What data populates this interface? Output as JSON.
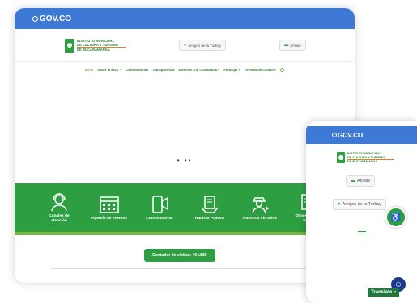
{
  "desktop": {
    "gov_logo": "GOV.CO",
    "brand": {
      "line1": "INSTITUTO MUNICIPAL",
      "line2": "DE CULTURA Y TURISMO",
      "line3": "DE BUCARAMANGA"
    },
    "header_buttons": {
      "amigos": "Amigos de la Turbay",
      "afiliate": "Afíliate"
    },
    "nav": [
      "Inicio",
      "Sobre el IMCT ˅",
      "Convocatorias",
      "Transparencia",
      "Atención a la Ciudadanía ˅",
      "Participa ˅",
      "Eventos de Ciudad ˅"
    ],
    "dots": "• ••",
    "services": [
      {
        "label": "Canales de atención",
        "icon": "headset-icon"
      },
      {
        "label": "Agenda de eventos",
        "icon": "calendar-icon"
      },
      {
        "label": "Convocatorias",
        "icon": "megaphone-phone-icon"
      },
      {
        "label": "Radicar PQRSD",
        "icon": "hand-document-icon"
      },
      {
        "label": "Nuestros circuitos",
        "icon": "guide-icon"
      },
      {
        "label": "Observatorio de turismo",
        "icon": "data-search-icon"
      }
    ],
    "counter": "Contador de visitas:  464.885"
  },
  "mobile": {
    "gov_logo": "GOV.CO",
    "brand": {
      "line1": "INSTITUTO MUNICIPAL",
      "line2": "DE CULTURA Y TURISMO",
      "line3": "DE BUCARAMANGA"
    },
    "afiliate": "Afíliate",
    "amigos": "Amigos de la Turbay",
    "translate": "Translate »"
  },
  "colors": {
    "gov_blue": "#3f79d6",
    "brand_green": "#2e9e43",
    "light_green": "#7cb342"
  }
}
